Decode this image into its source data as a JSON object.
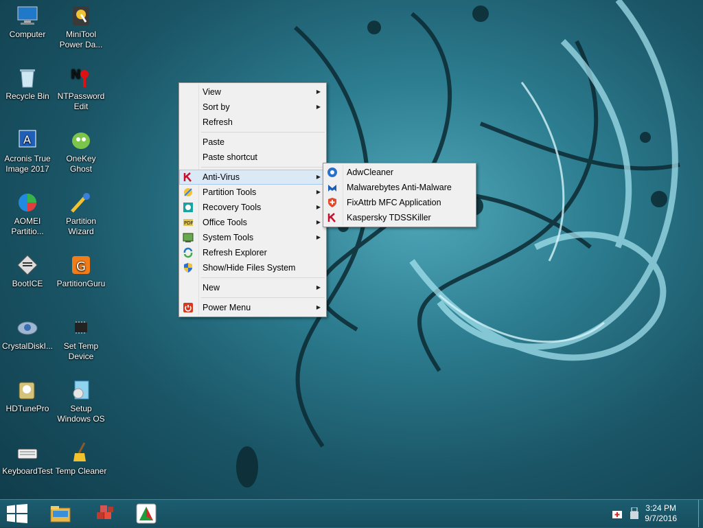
{
  "desktop": {
    "icons": [
      {
        "label": "Computer",
        "icon": "computer-icon"
      },
      {
        "label": "MiniTool\nPower Da...",
        "icon": "minitool-icon"
      },
      {
        "label": "Recycle Bin",
        "icon": "recycle-bin-icon"
      },
      {
        "label": "NTPassword\nEdit",
        "icon": "ntpassword-icon"
      },
      {
        "label": "Acronis True\nImage 2017",
        "icon": "acronis-icon"
      },
      {
        "label": "OneKey\nGhost",
        "icon": "onekey-ghost-icon"
      },
      {
        "label": "AOMEI\nPartitio...",
        "icon": "aomei-icon"
      },
      {
        "label": "Partition\nWizard",
        "icon": "partition-wizard-icon"
      },
      {
        "label": "BootICE",
        "icon": "bootice-icon"
      },
      {
        "label": "PartitionGuru",
        "icon": "partitionguru-icon"
      },
      {
        "label": "CrystalDiskI...",
        "icon": "crystaldisk-icon"
      },
      {
        "label": "Set Temp\nDevice",
        "icon": "chip-icon"
      },
      {
        "label": "HDTunePro",
        "icon": "hdtune-icon"
      },
      {
        "label": "Setup\nWindows OS",
        "icon": "setup-windows-icon"
      },
      {
        "label": "KeyboardTest",
        "icon": "keyboard-icon"
      },
      {
        "label": "Temp Cleaner",
        "icon": "broom-icon"
      }
    ]
  },
  "context_menu": {
    "items": [
      {
        "label": "View",
        "submenu": true
      },
      {
        "label": "Sort by",
        "submenu": true
      },
      {
        "label": "Refresh",
        "submenu": false
      },
      {
        "label": "Paste",
        "submenu": false
      },
      {
        "label": "Paste shortcut",
        "submenu": false
      },
      {
        "label": "Anti-Virus",
        "submenu": true,
        "icon": "kaspersky-icon",
        "highlighted": true
      },
      {
        "label": "Partition Tools",
        "submenu": true,
        "icon": "partition-tools-icon"
      },
      {
        "label": "Recovery Tools",
        "submenu": true,
        "icon": "recovery-tools-icon"
      },
      {
        "label": "Office Tools",
        "submenu": true,
        "icon": "office-tools-icon"
      },
      {
        "label": "System Tools",
        "submenu": true,
        "icon": "system-tools-icon"
      },
      {
        "label": "Refresh Explorer",
        "submenu": false,
        "icon": "refresh-explorer-icon"
      },
      {
        "label": "Show/Hide Files System",
        "submenu": false,
        "icon": "shield-icon"
      },
      {
        "label": "New",
        "submenu": true
      },
      {
        "label": "Power Menu",
        "submenu": true,
        "icon": "power-icon"
      }
    ]
  },
  "submenu": {
    "items": [
      {
        "label": "AdwCleaner",
        "icon": "adwcleaner-icon"
      },
      {
        "label": "Malwarebytes Anti-Malware",
        "icon": "malwarebytes-icon"
      },
      {
        "label": "FixAttrb MFC Application",
        "icon": "fixattrb-icon"
      },
      {
        "label": "Kaspersky TDSSKiller",
        "icon": "kaspersky-icon"
      }
    ]
  },
  "taskbar": {
    "start": "windows-start-icon",
    "pinned": [
      "file-explorer-icon",
      "cubes-icon",
      "paint-app-icon"
    ],
    "tray": [
      "first-aid-icon",
      "usb-icon"
    ],
    "time": "3:24 PM",
    "date": "9/7/2016"
  },
  "colors": {
    "taskbar": "#1a5667",
    "menu_bg": "#f0f0f0",
    "highlight": "#dbe8f6"
  }
}
